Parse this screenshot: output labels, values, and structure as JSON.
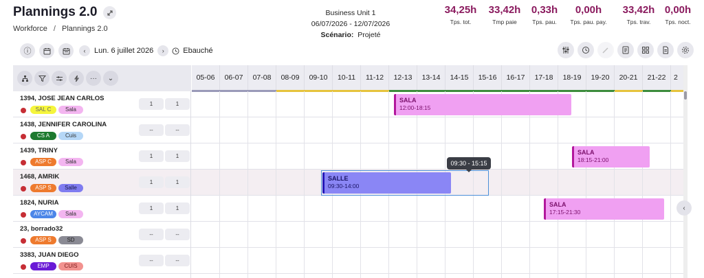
{
  "header": {
    "title": "Plannings 2.0",
    "breadcrumb": [
      "Workforce",
      "Plannings 2.0"
    ],
    "business_unit": "Business Unit 1",
    "date_range": "06/07/2026 - 12/07/2026",
    "scenario_label": "Scénario:",
    "scenario_value": "Projeté"
  },
  "stats": [
    {
      "value": "34,25h",
      "label": "Tps. tot."
    },
    {
      "value": "33,42h",
      "label": "Tmp paie"
    },
    {
      "value": "0,33h",
      "label": "Tps. pau."
    },
    {
      "value": "0,00h",
      "label": "Tps. pau. pay."
    },
    {
      "value": "33,42h",
      "label": "Tps. trav."
    },
    {
      "value": "0,00h",
      "label": "Tps. noct."
    }
  ],
  "toolbar": {
    "date": "Lun. 6 juillet 2026",
    "status": "Ebauché"
  },
  "time_slots": [
    "05-06",
    "06-07",
    "07-08",
    "08-09",
    "09-10",
    "10-11",
    "11-12",
    "12-13",
    "13-14",
    "14-15",
    "15-16",
    "16-17",
    "17-18",
    "18-19",
    "19-20",
    "20-21",
    "21-22",
    "2"
  ],
  "employees": [
    {
      "name": "1394, JOSE JEAN CARLOS",
      "tag1": "SAL C",
      "tag2": "Sala",
      "c1": "1",
      "c2": "1"
    },
    {
      "name": "1438, JENNIFER CAROLINA",
      "tag1": "CS A",
      "tag2": "Cuis",
      "c1": "--",
      "c2": "--"
    },
    {
      "name": "1439, TRINY",
      "tag1": "ASP C",
      "tag2": "Sala",
      "c1": "1",
      "c2": "1"
    },
    {
      "name": "1468, AMRIK",
      "tag1": "ASP S",
      "tag2": "Salle",
      "c1": "1",
      "c2": "1"
    },
    {
      "name": "1824, NURIA",
      "tag1": "AYCAM",
      "tag2": "Sala",
      "c1": "1",
      "c2": "1"
    },
    {
      "name": "23, borrado32",
      "tag1": "ASP S",
      "tag2": "SD",
      "c1": "--",
      "c2": "--"
    },
    {
      "name": "3383, JUAN DIEGO",
      "tag1": "EMP",
      "tag2": "CUIS",
      "c1": "--",
      "c2": "--"
    }
  ],
  "shifts": [
    {
      "title": "SALA",
      "time": "12:00-18:15"
    },
    {
      "title": "SALA",
      "time": "18:15-21:00"
    },
    {
      "title": "SALLE",
      "time": "09:30-14:00"
    },
    {
      "title": "SALA",
      "time": "17:15-21:30"
    }
  ],
  "tooltip": "09:30 - 15:15",
  "colors": {
    "stat_value": "#8a1a5e",
    "shift_pink_bg": "#f0a0f2",
    "shift_pink_border": "#b2179c",
    "shift_blue_bg": "#8a86f5",
    "shift_blue_border": "#2418b8",
    "dot_red": "#c62e35"
  }
}
